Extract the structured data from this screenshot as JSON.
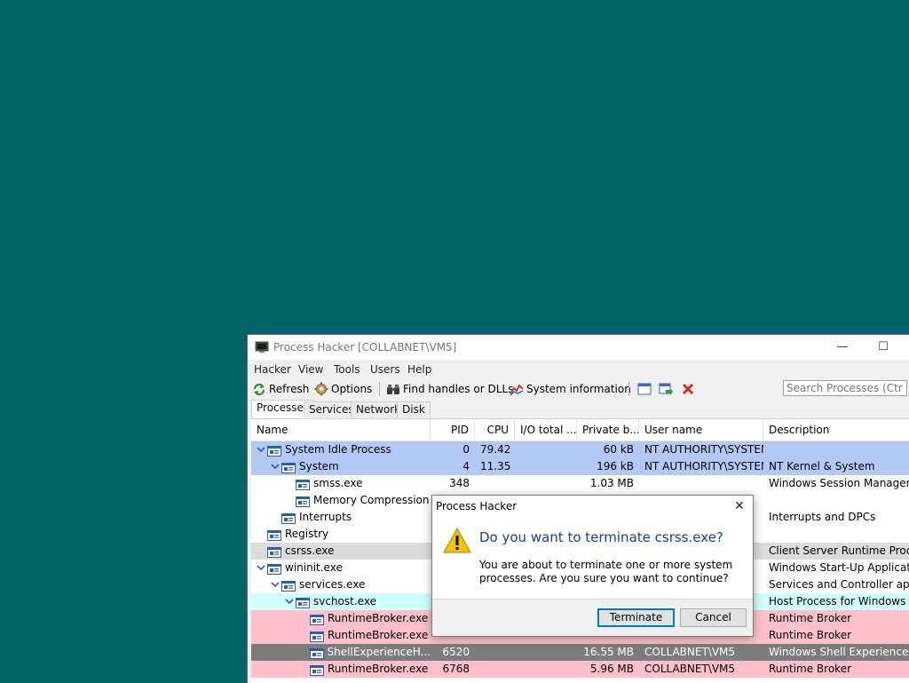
{
  "window": {
    "title": "Process Hacker [COLLABNET\\VM5]",
    "minimize_glyph": "—",
    "maximize_glyph": "☐"
  },
  "menu": [
    "Hacker",
    "View",
    "Tools",
    "Users",
    "Help"
  ],
  "toolbar": {
    "refresh": "Refresh",
    "options": "Options",
    "find_handles": "Find handles or DLLs",
    "system_information": "System information",
    "search_placeholder": "Search Processes (Ctrl+K)"
  },
  "tabs": [
    "Processes",
    "Services",
    "Network",
    "Disk"
  ],
  "columns": [
    "Name",
    "PID",
    "CPU",
    "I/O total ...",
    "Private b...",
    "User name",
    "Description"
  ],
  "rows": [
    {
      "name": "System Idle Process",
      "pid": "0",
      "cpu": "79.42",
      "io": "",
      "priv": "60 kB",
      "user": "NT AUTHORITY\\SYSTEM",
      "desc": "",
      "bg": "#b5c9f6"
    },
    {
      "name": "System",
      "pid": "4",
      "cpu": "11.35",
      "io": "",
      "priv": "196 kB",
      "user": "NT AUTHORITY\\SYSTEM",
      "desc": "NT Kernel & System",
      "bg": "#b5c9f6"
    },
    {
      "name": "smss.exe",
      "pid": "348",
      "cpu": "",
      "io": "",
      "priv": "1.03 MB",
      "user": "",
      "desc": "Windows Session Manager",
      "bg": "#ffffff"
    },
    {
      "name": "Memory Compression",
      "pid": "",
      "cpu": "",
      "io": "",
      "priv": "",
      "user": "",
      "desc": "",
      "bg": "#ffffff"
    },
    {
      "name": "Interrupts",
      "pid": "",
      "cpu": "",
      "io": "",
      "priv": "",
      "user": "",
      "desc": "Interrupts and DPCs",
      "bg": "#ffffff"
    },
    {
      "name": "Registry",
      "pid": "",
      "cpu": "",
      "io": "",
      "priv": "",
      "user": "",
      "desc": "",
      "bg": "#ffffff"
    },
    {
      "name": "csrss.exe",
      "pid": "",
      "cpu": "",
      "io": "",
      "priv": "",
      "user": "",
      "desc": "Client Server Runtime Process",
      "bg": "#dcdcdc"
    },
    {
      "name": "wininit.exe",
      "pid": "",
      "cpu": "",
      "io": "",
      "priv": "",
      "user": "",
      "desc": "Windows Start-Up Application",
      "bg": "#ffffff"
    },
    {
      "name": "services.exe",
      "pid": "",
      "cpu": "",
      "io": "",
      "priv": "",
      "user": "",
      "desc": "Services and Controller app",
      "bg": "#ffffff"
    },
    {
      "name": "svchost.exe",
      "pid": "",
      "cpu": "",
      "io": "",
      "priv": "",
      "user": "",
      "desc": "Host Process for Windows Ser...",
      "bg": "#d0ffff"
    },
    {
      "name": "RuntimeBroker.exe",
      "pid": "",
      "cpu": "",
      "io": "",
      "priv": "",
      "user": "",
      "desc": "Runtime Broker",
      "bg": "#ffc0cb"
    },
    {
      "name": "RuntimeBroker.exe",
      "pid": "",
      "cpu": "",
      "io": "",
      "priv": "",
      "user": "",
      "desc": "Runtime Broker",
      "bg": "#ffc0cb"
    },
    {
      "name": "ShellExperienceH...",
      "pid": "6520",
      "cpu": "",
      "io": "",
      "priv": "16.55 MB",
      "user": "COLLABNET\\VM5",
      "desc": "Windows Shell Experience Host",
      "bg": "#7c7c7c"
    },
    {
      "name": "RuntimeBroker.exe",
      "pid": "6768",
      "cpu": "",
      "io": "",
      "priv": "5.96 MB",
      "user": "COLLABNET\\VM5",
      "desc": "Runtime Broker",
      "bg": "#ffc0cb"
    }
  ],
  "dialog": {
    "title": "Process Hacker",
    "heading": "Do you want to terminate csrss.exe?",
    "message": "You are about to terminate one or more system processes. Are you sure you want to continue?",
    "terminate": "Terminate",
    "cancel": "Cancel",
    "close_glyph": "✕"
  }
}
